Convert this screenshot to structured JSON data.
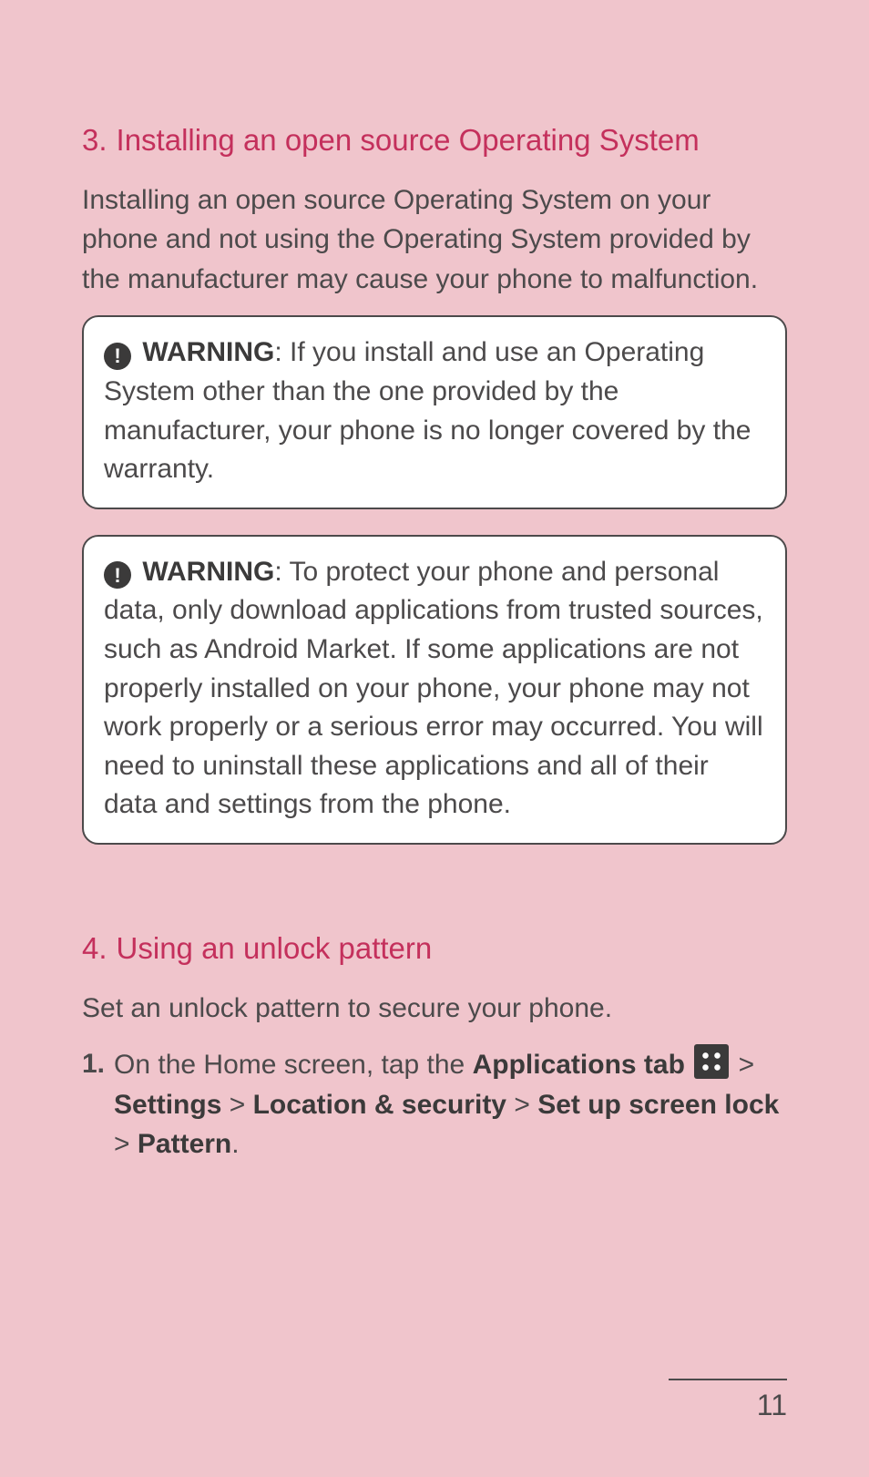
{
  "section3": {
    "number": "3.",
    "title": "Installing an open source Operating System",
    "body": "Installing an open source Operating System on your phone and not using the Operating System provided by the manufacturer may cause your phone to malfunction.",
    "warning1": {
      "label": "WARNING",
      "text": ": If you install and use an Operating System other than the one provided by the manufacturer, your phone is no longer covered by the warranty."
    },
    "warning2": {
      "label": "WARNING",
      "text": ": To protect your phone and personal data, only download applications from trusted sources, such as Android Market.  If some applications are not properly installed on your phone, your phone may not work properly or a serious error may occurred. You will need to uninstall these applications and all of their data and settings from the phone."
    }
  },
  "section4": {
    "number": "4.",
    "title": "Using an unlock pattern",
    "body": "Set an unlock pattern to secure your phone.",
    "step1": {
      "num": "1.",
      "t1": "On the Home screen, tap the ",
      "apps_tab": "Applications tab",
      "sep1": " > ",
      "settings": "Settings",
      "sep2": " > ",
      "loc_sec": "Location & security",
      "sep3": " > ",
      "setup": "Set up screen lock",
      "sep4": " > ",
      "pattern": "Pattern",
      "end": "."
    }
  },
  "icons": {
    "warning_glyph": "!",
    "apps_name": "applications-tab-icon"
  },
  "page_number": "11"
}
